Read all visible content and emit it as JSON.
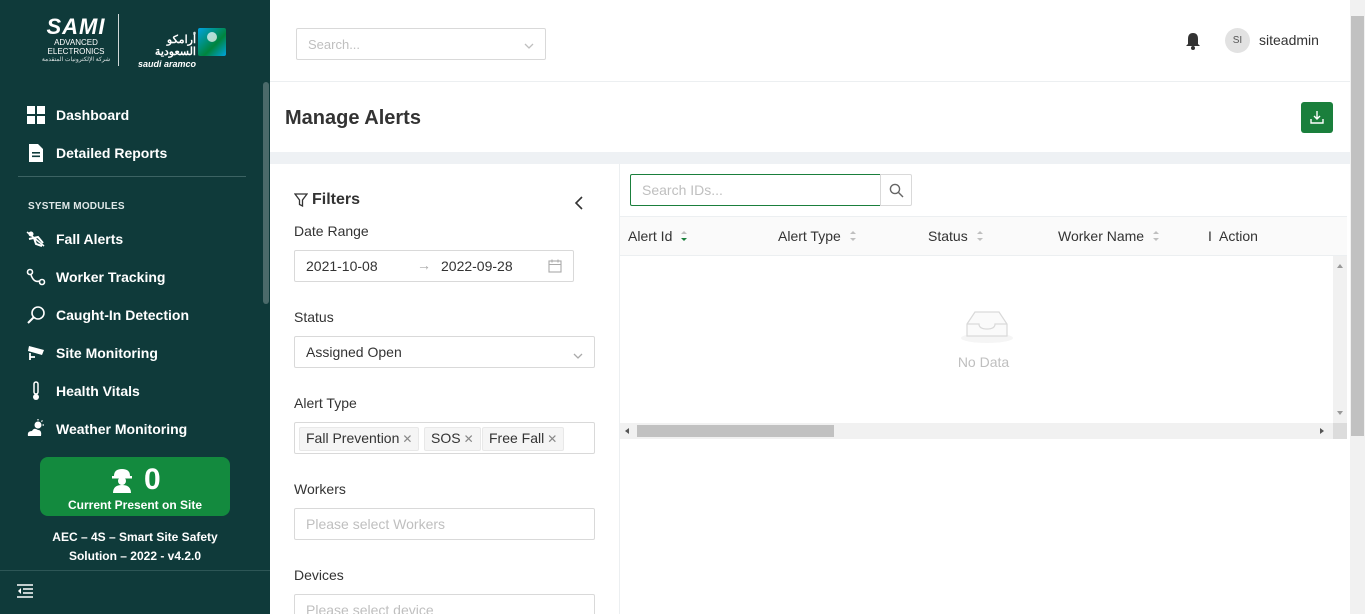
{
  "sidebar": {
    "logo": {
      "brand": "SAMI",
      "brand_sub1": "ADVANCED",
      "brand_sub2": "ELECTRONICS",
      "brand_ar": "شركة الإلكترونيات المتقدمة",
      "partner_ar": "أرامكو السعودية",
      "partner_en": "saudi aramco"
    },
    "main_items": [
      {
        "label": "Dashboard",
        "icon": "dashboard-grid-icon"
      },
      {
        "label": "Detailed Reports",
        "icon": "document-icon"
      }
    ],
    "section_title": "SYSTEM MODULES",
    "module_items": [
      {
        "label": "Fall Alerts",
        "icon": "fall-person-icon"
      },
      {
        "label": "Worker Tracking",
        "icon": "route-icon"
      },
      {
        "label": "Caught-In Detection",
        "icon": "magnifier-icon"
      },
      {
        "label": "Site Monitoring",
        "icon": "cctv-camera-icon"
      },
      {
        "label": "Health Vitals",
        "icon": "thermometer-icon"
      },
      {
        "label": "Weather Monitoring",
        "icon": "weather-icon"
      }
    ],
    "present_card": {
      "count": "0",
      "label": "Current Present on Site",
      "icon": "worker-helmet-icon"
    },
    "version_line1": "AEC – 4S – Smart Site Safety",
    "version_line2": "Solution – 2022 - v4.2.0"
  },
  "header": {
    "search_placeholder": "Search...",
    "avatar_initials": "SI",
    "username": "siteadmin"
  },
  "page": {
    "title": "Manage Alerts"
  },
  "filters": {
    "title": "Filters",
    "date_range_label": "Date Range",
    "date_from": "2021-10-08",
    "date_to": "2022-09-28",
    "status_label": "Status",
    "status_value": "Assigned Open",
    "alert_type_label": "Alert Type",
    "alert_types": [
      "Fall Prevention",
      "SOS",
      "Free Fall"
    ],
    "workers_label": "Workers",
    "workers_placeholder": "Please select Workers",
    "devices_label": "Devices",
    "devices_placeholder": "Please select device"
  },
  "table": {
    "search_placeholder": "Search IDs...",
    "columns": [
      "Alert Id",
      "Alert Type",
      "Status",
      "Worker Name",
      "I",
      "Action"
    ],
    "empty_text": "No Data"
  },
  "colors": {
    "sidebar_bg": "#0f3a3a",
    "accent_green": "#1a7f3c",
    "card_green": "#138a3e"
  }
}
